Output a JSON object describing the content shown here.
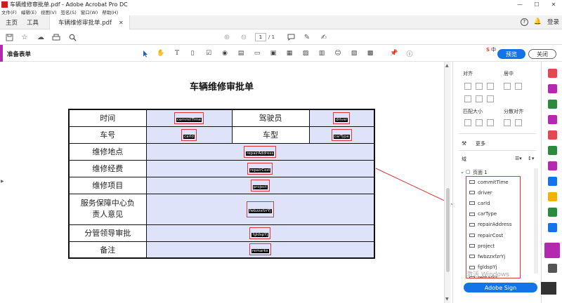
{
  "window": {
    "title": "车辆维修审批单.pdf - Adobe Acrobat Pro DC",
    "controls": [
      "—",
      "☐",
      "✕"
    ]
  },
  "menu": [
    "文件(F)",
    "编辑(E)",
    "视图(V)",
    "签名(S)",
    "窗口(W)",
    "帮助(H)"
  ],
  "tabs": {
    "home": "主页",
    "tools": "工具",
    "document": "车辆维修审批单.pdf",
    "login": "登录"
  },
  "toolbar": {
    "page_current": "1",
    "page_total": "/ 1"
  },
  "formbar": {
    "label": "准备表单",
    "preview": "预览",
    "close": "关闭",
    "ime": "中"
  },
  "form": {
    "title": "车辆维修审批单",
    "rows": [
      {
        "label": "时间",
        "field": "commitTime",
        "label2": "驾驶员",
        "field2": "driver"
      },
      {
        "label": "车号",
        "field": "carId",
        "label2": "车型",
        "field2": "carType"
      },
      {
        "label": "维修地点",
        "field": "repairAddress"
      },
      {
        "label": "维修经费",
        "field": "repairCost"
      },
      {
        "label": "维修项目",
        "field": "project"
      },
      {
        "label": "服务保障中心负责人意见",
        "label_line1": "服务保障中心负",
        "label_line2": "责人意见",
        "field": "fwbzzxfzrYj"
      },
      {
        "label": "分管领导审批",
        "field": "fgldspYj"
      },
      {
        "label": "备注",
        "field": "remarks"
      }
    ]
  },
  "right_panel": {
    "align": "对齐",
    "center": "居中",
    "match_size": "匹配大小",
    "distribute": "分散对齐",
    "more": "更多",
    "fields_heading": "域",
    "page_node": "页面 1",
    "fields": [
      "commitTime",
      "driver",
      "carId",
      "carType",
      "repairAddress",
      "repairCost",
      "project",
      "fwbzzxfzrYj",
      "fgldspYj",
      "remarks"
    ],
    "adobe_sign": "Adobe Sign",
    "watermark": "激活 Windows"
  },
  "colors": {
    "accent": "#1473e6",
    "form_tool_purple": "#b32ab1",
    "field_fill": "#dfe3fa",
    "highlight_red": "#d63a3a"
  }
}
